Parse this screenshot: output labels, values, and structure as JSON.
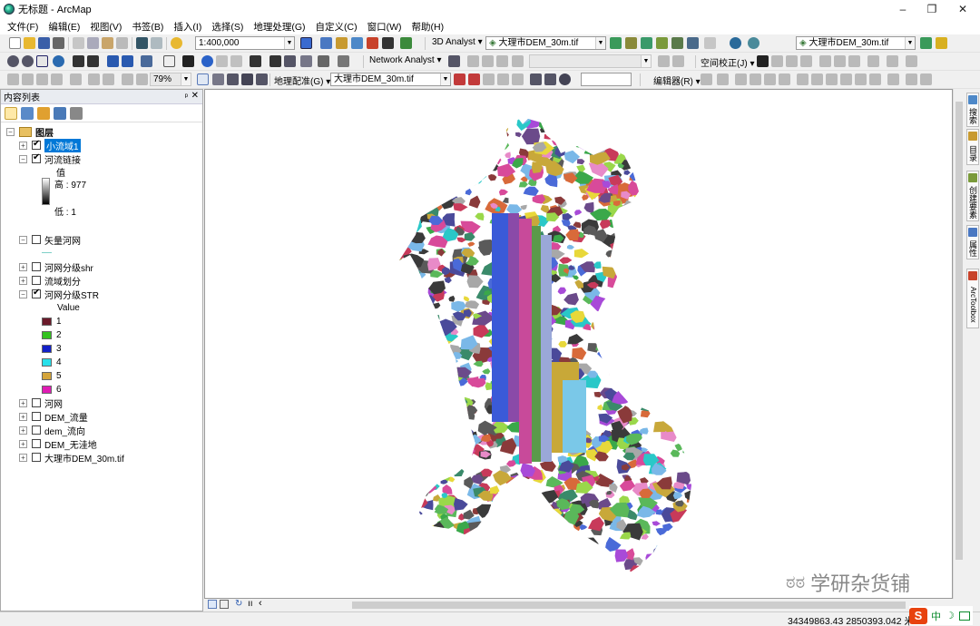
{
  "window": {
    "title": "无标题 - ArcMap",
    "controls": [
      "–",
      "❐",
      "✕"
    ]
  },
  "menubar": {
    "items": [
      "文件(F)",
      "编辑(E)",
      "视图(V)",
      "书签(B)",
      "插入(I)",
      "选择(S)",
      "地理处理(G)",
      "自定义(C)",
      "窗口(W)",
      "帮助(H)"
    ]
  },
  "toolbar1": {
    "scale": "1:400,000",
    "analyst_3d": "3D Analyst ▾",
    "layer_combo_1": "大理市DEM_30m.tif",
    "layer_combo_2": "大理市DEM_30m.tif"
  },
  "toolbar2": {
    "network_analyst": "Network Analyst ▾",
    "spatial_adjust": "空间校正(J) ▾"
  },
  "toolbar3": {
    "zoom_percent": "79%",
    "georef_label": "地理配准(G) ▾",
    "georef_layer": "大理市DEM_30m.tif",
    "editor": "编辑器(R) ▾"
  },
  "toc": {
    "title": "内容列表",
    "pin": "ᵖ",
    "close": "✕",
    "root": "图层",
    "layers": [
      {
        "name": "小流域1",
        "checked": true,
        "selected": true,
        "expanded": false
      },
      {
        "name": "河流链接",
        "checked": true,
        "expanded": true
      },
      {
        "name": "矢量河网",
        "checked": false,
        "expanded": true
      },
      {
        "name": "河网分级shr",
        "checked": false,
        "expanded": false
      },
      {
        "name": "流域划分",
        "checked": false,
        "expanded": false
      },
      {
        "name": "河网分级STR",
        "checked": true,
        "expanded": true
      },
      {
        "name": "河网",
        "checked": false,
        "expanded": false
      },
      {
        "name": "DEM_流量",
        "checked": false,
        "expanded": false
      },
      {
        "name": "dem_流向",
        "checked": false,
        "expanded": false
      },
      {
        "name": "DEM_无洼地",
        "checked": false,
        "expanded": false
      },
      {
        "name": "大理市DEM_30m.tif",
        "checked": false,
        "expanded": false
      }
    ],
    "river_link_legend": {
      "heading": "值",
      "high": "高 : 977",
      "low": "低 : 1"
    },
    "str_legend": {
      "heading": "Value",
      "classes": [
        {
          "label": "1",
          "color": "#6b1a2a"
        },
        {
          "label": "2",
          "color": "#33c21f"
        },
        {
          "label": "3",
          "color": "#1220c8"
        },
        {
          "label": "4",
          "color": "#28e0ea"
        },
        {
          "label": "5",
          "color": "#d4a43a"
        },
        {
          "label": "6",
          "color": "#e01cb4"
        }
      ]
    },
    "vector_line_color": "#7fd0c8"
  },
  "right_dock": {
    "tabs": [
      "搜索",
      "目录",
      "创建要素",
      "属性",
      "ArcToolbox"
    ]
  },
  "watermark": {
    "text": "学研杂货铺"
  },
  "statusbar": {
    "coordinates": "34349863.43  2850393.042 米"
  },
  "ime": {
    "s": "S",
    "zh": "中",
    "moon": "☽"
  }
}
